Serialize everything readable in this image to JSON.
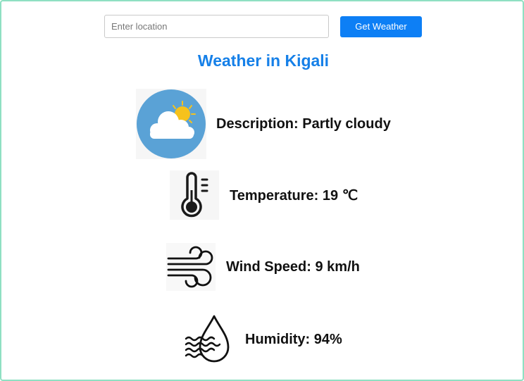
{
  "search": {
    "placeholder": "Enter location",
    "value": "",
    "button_label": "Get Weather"
  },
  "title": "Weather in Kigali",
  "weather": {
    "description": "Description: Partly cloudy",
    "temperature": "Temperature: 19 ℃",
    "wind_speed": "Wind Speed: 9 km/h",
    "humidity": "Humidity: 94%"
  },
  "icons": {
    "description": "partly-cloudy-icon",
    "temperature": "thermometer-icon",
    "wind_speed": "wind-icon",
    "humidity": "humidity-drop-icon"
  },
  "colors": {
    "accent": "#0d7ff5",
    "title": "#1680e8",
    "border": "#8fe0c2",
    "weather_circle": "#5aa2d6",
    "sun": "#f6c21c"
  }
}
